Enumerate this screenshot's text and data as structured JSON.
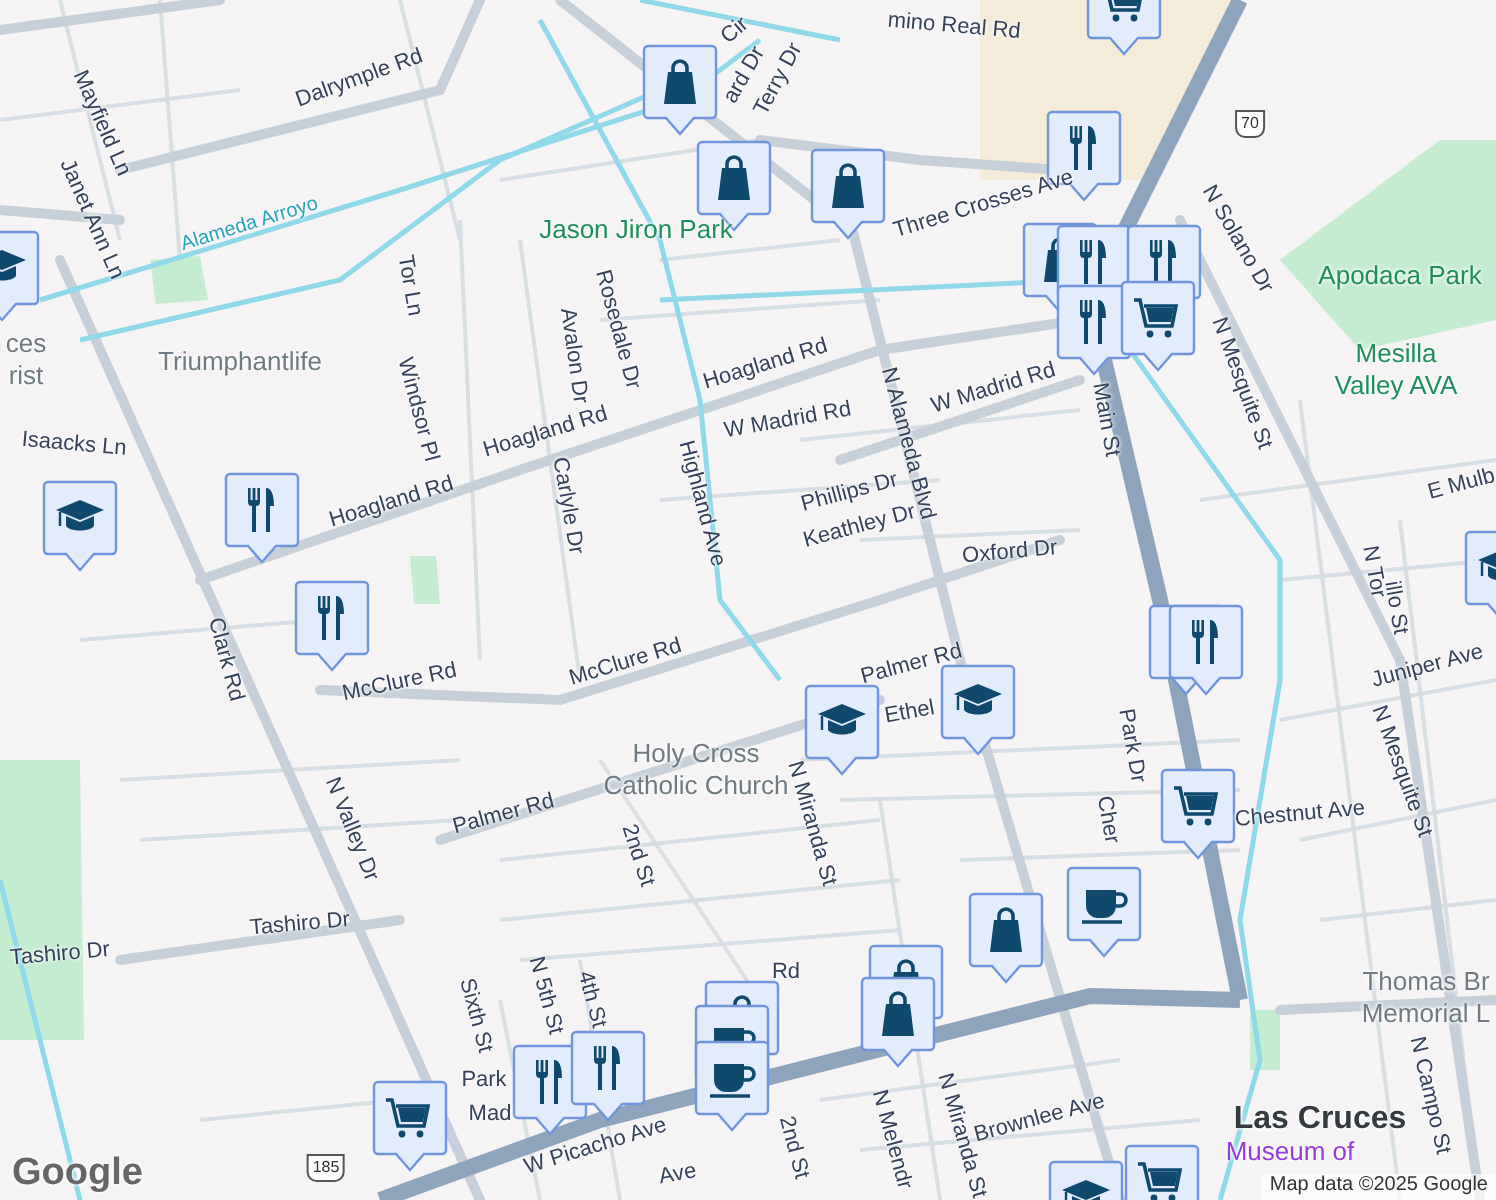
{
  "map": {
    "labels": [
      {
        "text": "Dalrymple Rd",
        "kind": "street"
      },
      {
        "text": "Mayfield Ln",
        "kind": "street"
      },
      {
        "text": "Janet Ann Ln",
        "kind": "street"
      },
      {
        "text": "Alameda Arroyo",
        "kind": "water"
      },
      {
        "text": "Tor Ln",
        "kind": "street"
      },
      {
        "text": "Windsor Pl",
        "kind": "street"
      },
      {
        "text": "Avalon Dr",
        "kind": "street"
      },
      {
        "text": "Rosedale Dr",
        "kind": "street"
      },
      {
        "text": "Carlyle Dr",
        "kind": "street"
      },
      {
        "text": "Highland Ave",
        "kind": "street"
      },
      {
        "text": "Hoagland Rd",
        "kind": "street"
      },
      {
        "text": "Hoagland Rd",
        "kind": "street"
      },
      {
        "text": "Hoagland Rd",
        "kind": "street"
      },
      {
        "text": "W Madrid Rd",
        "kind": "street"
      },
      {
        "text": "W Madrid Rd",
        "kind": "street"
      },
      {
        "text": "Isaacks Ln",
        "kind": "street"
      },
      {
        "text": "Clark Rd",
        "kind": "street"
      },
      {
        "text": "McClure Rd",
        "kind": "street"
      },
      {
        "text": "McClure Rd",
        "kind": "street"
      },
      {
        "text": "N Valley Dr",
        "kind": "street"
      },
      {
        "text": "Palmer Rd",
        "kind": "street"
      },
      {
        "text": "Tashiro Dr",
        "kind": "street"
      },
      {
        "text": "Tashiro Dr",
        "kind": "street"
      },
      {
        "text": "2nd St",
        "kind": "street"
      },
      {
        "text": "Sixth St",
        "kind": "street"
      },
      {
        "text": "N 5th St",
        "kind": "street"
      },
      {
        "text": "4th St",
        "kind": "street"
      },
      {
        "text": "Palmer Rd",
        "kind": "street"
      },
      {
        "text": "Ethel",
        "kind": "street"
      },
      {
        "text": "N Miranda St",
        "kind": "street"
      },
      {
        "text": "Park Dr",
        "kind": "street"
      },
      {
        "text": "Cher",
        "kind": "street"
      },
      {
        "text": "Chestnut Ave",
        "kind": "street"
      },
      {
        "text": "N Mesquite St",
        "kind": "street"
      },
      {
        "text": "N Mesquite St",
        "kind": "street"
      },
      {
        "text": "N Solano Dr",
        "kind": "street"
      },
      {
        "text": "N Alameda Blvd",
        "kind": "street"
      },
      {
        "text": "Phillips Dr",
        "kind": "street"
      },
      {
        "text": "Keathley Dr",
        "kind": "street"
      },
      {
        "text": "Oxford Dr",
        "kind": "street"
      },
      {
        "text": "Main St",
        "kind": "street"
      },
      {
        "text": "Three Crosses Ave",
        "kind": "street"
      },
      {
        "text": "mino Real Rd",
        "kind": "street"
      },
      {
        "text": "Terry Dr",
        "kind": "street"
      },
      {
        "text": "Cir",
        "kind": "street"
      },
      {
        "text": "ard Dr",
        "kind": "street"
      },
      {
        "text": "Juniper Ave",
        "kind": "street"
      },
      {
        "text": "E Mulb",
        "kind": "street"
      },
      {
        "text": "N Tor",
        "kind": "street"
      },
      {
        "text": "illo St",
        "kind": "street"
      },
      {
        "text": "Brownlee Ave",
        "kind": "street"
      },
      {
        "text": "N Melendr",
        "kind": "street"
      },
      {
        "text": "N Miranda St",
        "kind": "street"
      },
      {
        "text": "W Picacho Ave",
        "kind": "street"
      },
      {
        "text": "N Campo St",
        "kind": "street"
      },
      {
        "text": "Park",
        "kind": "street"
      },
      {
        "text": "Mad",
        "kind": "street"
      },
      {
        "text": "Ave",
        "kind": "street"
      },
      {
        "text": "Rd",
        "kind": "street"
      },
      {
        "text": "2nd St",
        "kind": "street"
      },
      {
        "text": "Jason Jiron Park",
        "kind": "park"
      },
      {
        "text": "Apodaca Park",
        "kind": "park"
      },
      {
        "text": "ces\nrist",
        "kind": "place"
      },
      {
        "text": "Triumphantlife",
        "kind": "place"
      },
      {
        "text": "Mesilla\nValley AVA",
        "kind": "park"
      },
      {
        "text": "Holy Cross\nCatholic Church",
        "kind": "place"
      },
      {
        "text": "Thomas Br\nMemorial L",
        "kind": "place"
      },
      {
        "text": "Las Cruces",
        "kind": "city"
      },
      {
        "text": "Museum of",
        "kind": "museum"
      }
    ],
    "route_shields": [
      "185",
      "70"
    ],
    "pins": [
      {
        "kind": "shopping"
      },
      {
        "kind": "shopping"
      },
      {
        "kind": "shopping"
      },
      {
        "kind": "shopping"
      },
      {
        "kind": "shopping"
      },
      {
        "kind": "shopping"
      },
      {
        "kind": "shopping"
      },
      {
        "kind": "shopping"
      },
      {
        "kind": "restaurant"
      },
      {
        "kind": "restaurant"
      },
      {
        "kind": "restaurant"
      },
      {
        "kind": "restaurant"
      },
      {
        "kind": "restaurant"
      },
      {
        "kind": "restaurant"
      },
      {
        "kind": "restaurant"
      },
      {
        "kind": "restaurant"
      },
      {
        "kind": "restaurant"
      },
      {
        "kind": "restaurant"
      },
      {
        "kind": "grocery"
      },
      {
        "kind": "grocery"
      },
      {
        "kind": "grocery"
      },
      {
        "kind": "grocery"
      },
      {
        "kind": "grocery"
      },
      {
        "kind": "school"
      },
      {
        "kind": "school"
      },
      {
        "kind": "school"
      },
      {
        "kind": "school"
      },
      {
        "kind": "school"
      },
      {
        "kind": "school"
      },
      {
        "kind": "cafe"
      },
      {
        "kind": "cafe"
      },
      {
        "kind": "cafe"
      }
    ],
    "logo": "Google",
    "attribution": "Map data ©2025 Google"
  }
}
